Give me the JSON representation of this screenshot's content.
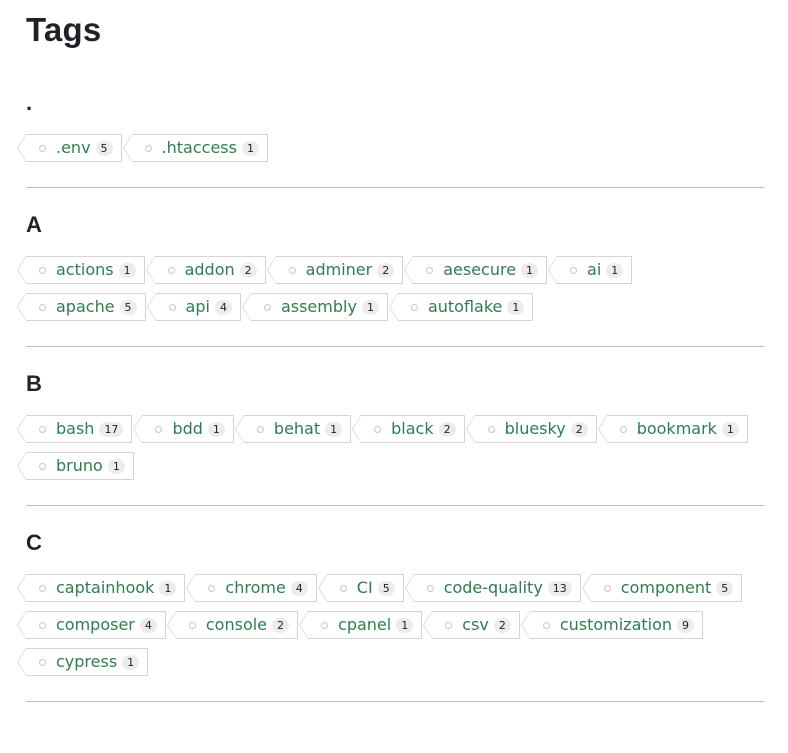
{
  "page": {
    "title": "Tags"
  },
  "sections": [
    {
      "heading": ".",
      "tags": [
        {
          "name": ".env",
          "count": "5"
        },
        {
          "name": ".htaccess",
          "count": "1"
        }
      ]
    },
    {
      "heading": "A",
      "tags": [
        {
          "name": "actions",
          "count": "1"
        },
        {
          "name": "addon",
          "count": "2"
        },
        {
          "name": "adminer",
          "count": "2"
        },
        {
          "name": "aesecure",
          "count": "1"
        },
        {
          "name": "ai",
          "count": "1"
        },
        {
          "name": "apache",
          "count": "5"
        },
        {
          "name": "api",
          "count": "4"
        },
        {
          "name": "assembly",
          "count": "1"
        },
        {
          "name": "autoflake",
          "count": "1"
        }
      ]
    },
    {
      "heading": "B",
      "tags": [
        {
          "name": "bash",
          "count": "17"
        },
        {
          "name": "bdd",
          "count": "1"
        },
        {
          "name": "behat",
          "count": "1"
        },
        {
          "name": "black",
          "count": "2"
        },
        {
          "name": "bluesky",
          "count": "2"
        },
        {
          "name": "bookmark",
          "count": "1"
        },
        {
          "name": "bruno",
          "count": "1"
        }
      ]
    },
    {
      "heading": "C",
      "tags": [
        {
          "name": "captainhook",
          "count": "1"
        },
        {
          "name": "chrome",
          "count": "4"
        },
        {
          "name": "CI",
          "count": "5"
        },
        {
          "name": "code-quality",
          "count": "13"
        },
        {
          "name": "component",
          "count": "5"
        },
        {
          "name": "composer",
          "count": "4"
        },
        {
          "name": "console",
          "count": "2"
        },
        {
          "name": "cpanel",
          "count": "1"
        },
        {
          "name": "csv",
          "count": "2"
        },
        {
          "name": "customization",
          "count": "9"
        },
        {
          "name": "cypress",
          "count": "1"
        }
      ]
    }
  ]
}
